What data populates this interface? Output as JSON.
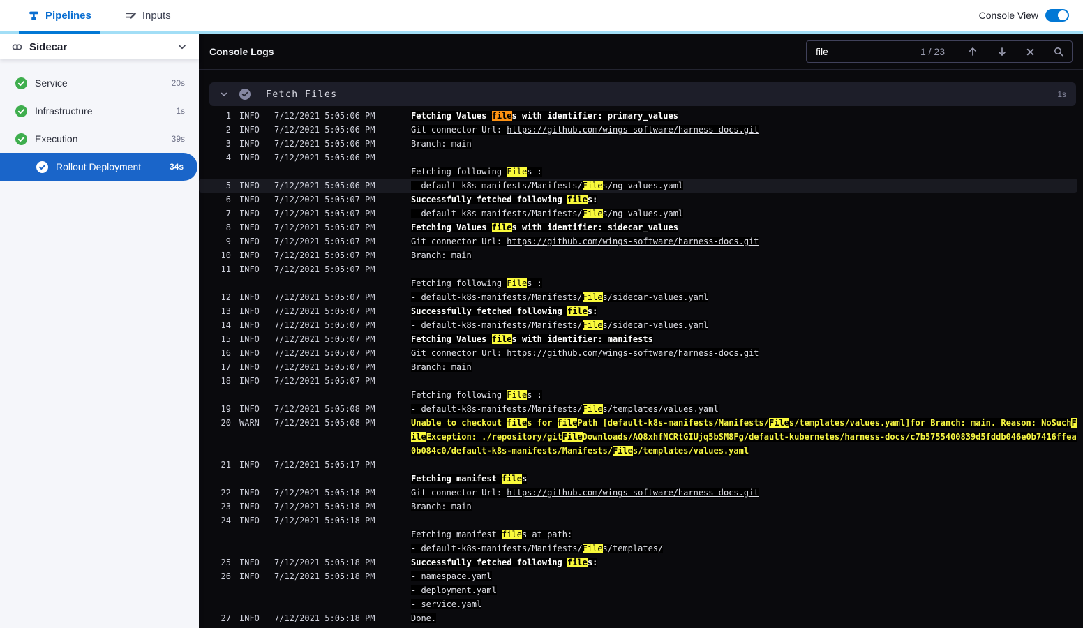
{
  "topbar": {
    "tabs": [
      {
        "label": "Pipelines",
        "active": true
      },
      {
        "label": "Inputs",
        "active": false
      }
    ],
    "console_view_label": "Console View",
    "console_view_on": true
  },
  "sidebar": {
    "title": "Sidecar",
    "items": [
      {
        "label": "Service",
        "duration": "20s",
        "status": "success",
        "selected": false
      },
      {
        "label": "Infrastructure",
        "duration": "1s",
        "status": "success",
        "selected": false
      },
      {
        "label": "Execution",
        "duration": "39s",
        "status": "success",
        "selected": false
      },
      {
        "label": "Rollout Deployment",
        "duration": "34s",
        "status": "success",
        "selected": true
      }
    ]
  },
  "console": {
    "title": "Console Logs",
    "search": {
      "value": "file",
      "counter": "1 / 23"
    },
    "group": {
      "title": "Fetch Files",
      "duration": "1s",
      "status": "success"
    },
    "colors": {
      "accent_blue": "#0278d5",
      "selected_blue": "#1a65c9",
      "success_green": "#3fae4e",
      "warn_yellow": "#f6f643",
      "match_yellow": "#f9f93b",
      "match_current_orange": "#ff9212",
      "console_bg": "#0a0a0d"
    },
    "rows": [
      {
        "n": "1",
        "lvl": "INFO",
        "ts": "7/12/2021 5:05:06 PM",
        "b": 1,
        "seg": [
          {
            "t": "Fetching Values "
          },
          {
            "t": "file",
            "m": "cur"
          },
          {
            "t": "s with identifier: primary_values"
          }
        ]
      },
      {
        "n": "2",
        "lvl": "INFO",
        "ts": "7/12/2021 5:05:06 PM",
        "seg": [
          {
            "t": "Git connector Url: "
          },
          {
            "t": "https://github.com/wings-software/harness-docs.git",
            "link": 1
          }
        ]
      },
      {
        "n": "3",
        "lvl": "INFO",
        "ts": "7/12/2021 5:05:06 PM",
        "seg": [
          {
            "t": "Branch: main"
          }
        ]
      },
      {
        "n": "4",
        "lvl": "INFO",
        "ts": "7/12/2021 5:05:06 PM",
        "seg": []
      },
      {
        "seg": [
          {
            "t": "Fetching following "
          },
          {
            "t": "File",
            "m": "hit"
          },
          {
            "t": "s :"
          }
        ]
      },
      {
        "n": "5",
        "lvl": "INFO",
        "ts": "7/12/2021 5:05:06 PM",
        "hl": 1,
        "seg": [
          {
            "t": "- default-k8s-manifests/Manifests/"
          },
          {
            "t": "File",
            "m": "hit"
          },
          {
            "t": "s/ng-values.yaml"
          }
        ]
      },
      {
        "n": "6",
        "lvl": "INFO",
        "ts": "7/12/2021 5:05:07 PM",
        "b": 1,
        "seg": [
          {
            "t": "Successfully fetched following "
          },
          {
            "t": "file",
            "m": "hit"
          },
          {
            "t": "s:"
          }
        ]
      },
      {
        "n": "7",
        "lvl": "INFO",
        "ts": "7/12/2021 5:05:07 PM",
        "seg": [
          {
            "t": "- default-k8s-manifests/Manifests/"
          },
          {
            "t": "File",
            "m": "hit"
          },
          {
            "t": "s/ng-values.yaml"
          }
        ]
      },
      {
        "n": "8",
        "lvl": "INFO",
        "ts": "7/12/2021 5:05:07 PM",
        "b": 1,
        "seg": [
          {
            "t": "Fetching Values "
          },
          {
            "t": "file",
            "m": "hit"
          },
          {
            "t": "s with identifier: sidecar_values"
          }
        ]
      },
      {
        "n": "9",
        "lvl": "INFO",
        "ts": "7/12/2021 5:05:07 PM",
        "seg": [
          {
            "t": "Git connector Url: "
          },
          {
            "t": "https://github.com/wings-software/harness-docs.git",
            "link": 1
          }
        ]
      },
      {
        "n": "10",
        "lvl": "INFO",
        "ts": "7/12/2021 5:05:07 PM",
        "seg": [
          {
            "t": "Branch: main"
          }
        ]
      },
      {
        "n": "11",
        "lvl": "INFO",
        "ts": "7/12/2021 5:05:07 PM",
        "seg": []
      },
      {
        "seg": [
          {
            "t": "Fetching following "
          },
          {
            "t": "File",
            "m": "hit"
          },
          {
            "t": "s :"
          }
        ]
      },
      {
        "n": "12",
        "lvl": "INFO",
        "ts": "7/12/2021 5:05:07 PM",
        "seg": [
          {
            "t": "- default-k8s-manifests/Manifests/"
          },
          {
            "t": "File",
            "m": "hit"
          },
          {
            "t": "s/sidecar-values.yaml"
          }
        ]
      },
      {
        "n": "13",
        "lvl": "INFO",
        "ts": "7/12/2021 5:05:07 PM",
        "b": 1,
        "seg": [
          {
            "t": "Successfully fetched following "
          },
          {
            "t": "file",
            "m": "hit"
          },
          {
            "t": "s:"
          }
        ]
      },
      {
        "n": "14",
        "lvl": "INFO",
        "ts": "7/12/2021 5:05:07 PM",
        "seg": [
          {
            "t": "- default-k8s-manifests/Manifests/"
          },
          {
            "t": "File",
            "m": "hit"
          },
          {
            "t": "s/sidecar-values.yaml"
          }
        ]
      },
      {
        "n": "15",
        "lvl": "INFO",
        "ts": "7/12/2021 5:05:07 PM",
        "b": 1,
        "seg": [
          {
            "t": "Fetching Values "
          },
          {
            "t": "file",
            "m": "hit"
          },
          {
            "t": "s with identifier: manifests"
          }
        ]
      },
      {
        "n": "16",
        "lvl": "INFO",
        "ts": "7/12/2021 5:05:07 PM",
        "seg": [
          {
            "t": "Git connector Url: "
          },
          {
            "t": "https://github.com/wings-software/harness-docs.git",
            "link": 1
          }
        ]
      },
      {
        "n": "17",
        "lvl": "INFO",
        "ts": "7/12/2021 5:05:07 PM",
        "seg": [
          {
            "t": "Branch: main"
          }
        ]
      },
      {
        "n": "18",
        "lvl": "INFO",
        "ts": "7/12/2021 5:05:07 PM",
        "seg": []
      },
      {
        "seg": [
          {
            "t": "Fetching following "
          },
          {
            "t": "File",
            "m": "hit"
          },
          {
            "t": "s :"
          }
        ]
      },
      {
        "n": "19",
        "lvl": "INFO",
        "ts": "7/12/2021 5:05:08 PM",
        "seg": [
          {
            "t": "- default-k8s-manifests/Manifests/"
          },
          {
            "t": "File",
            "m": "hit"
          },
          {
            "t": "s/templates/values.yaml"
          }
        ]
      },
      {
        "n": "20",
        "lvl": "WARN",
        "ts": "7/12/2021 5:05:08 PM",
        "b": 1,
        "w": 1,
        "seg": [
          {
            "t": "Unable to checkout "
          },
          {
            "t": "file",
            "m": "hit"
          },
          {
            "t": "s for "
          },
          {
            "t": "file",
            "m": "hit"
          },
          {
            "t": "Path [default-k8s-manifests/Manifests/"
          },
          {
            "t": "File",
            "m": "hit"
          },
          {
            "t": "s/templates/values.yaml]for Branch: main. Reason: NoSuch"
          },
          {
            "t": "File",
            "m": "hit"
          },
          {
            "t": "Exception: ./repository/git"
          },
          {
            "t": "File",
            "m": "hit"
          },
          {
            "t": "Downloads/AQ8xhfNCRtGIUjq5bSM8Fg/default-kubernetes/harness-docs/c7b5755400839d5fddb046e0b7416ffea0b084c0/default-k8s-manifests/Manifests/"
          },
          {
            "t": "File",
            "m": "hit"
          },
          {
            "t": "s/templates/values.yaml"
          }
        ]
      },
      {
        "n": "21",
        "lvl": "INFO",
        "ts": "7/12/2021 5:05:17 PM",
        "seg": []
      },
      {
        "b": 1,
        "seg": [
          {
            "t": "Fetching manifest "
          },
          {
            "t": "file",
            "m": "hit"
          },
          {
            "t": "s"
          }
        ]
      },
      {
        "n": "22",
        "lvl": "INFO",
        "ts": "7/12/2021 5:05:18 PM",
        "seg": [
          {
            "t": "Git connector Url: "
          },
          {
            "t": "https://github.com/wings-software/harness-docs.git",
            "link": 1
          }
        ]
      },
      {
        "n": "23",
        "lvl": "INFO",
        "ts": "7/12/2021 5:05:18 PM",
        "seg": [
          {
            "t": "Branch: main"
          }
        ]
      },
      {
        "n": "24",
        "lvl": "INFO",
        "ts": "7/12/2021 5:05:18 PM",
        "seg": []
      },
      {
        "seg": [
          {
            "t": "Fetching manifest "
          },
          {
            "t": "file",
            "m": "hit"
          },
          {
            "t": "s at path:"
          }
        ]
      },
      {
        "seg": [
          {
            "t": "- default-k8s-manifests/Manifests/"
          },
          {
            "t": "File",
            "m": "hit"
          },
          {
            "t": "s/templates/"
          }
        ]
      },
      {
        "n": "25",
        "lvl": "INFO",
        "ts": "7/12/2021 5:05:18 PM",
        "b": 1,
        "seg": [
          {
            "t": "Successfully fetched following "
          },
          {
            "t": "file",
            "m": "hit"
          },
          {
            "t": "s:"
          }
        ]
      },
      {
        "n": "26",
        "lvl": "INFO",
        "ts": "7/12/2021 5:05:18 PM",
        "seg": [
          {
            "t": "- namespace.yaml"
          }
        ]
      },
      {
        "seg": [
          {
            "t": "- deployment.yaml"
          }
        ]
      },
      {
        "seg": [
          {
            "t": "- service.yaml"
          }
        ]
      },
      {
        "n": "27",
        "lvl": "INFO",
        "ts": "7/12/2021 5:05:18 PM",
        "seg": [
          {
            "t": "Done."
          }
        ]
      }
    ]
  }
}
